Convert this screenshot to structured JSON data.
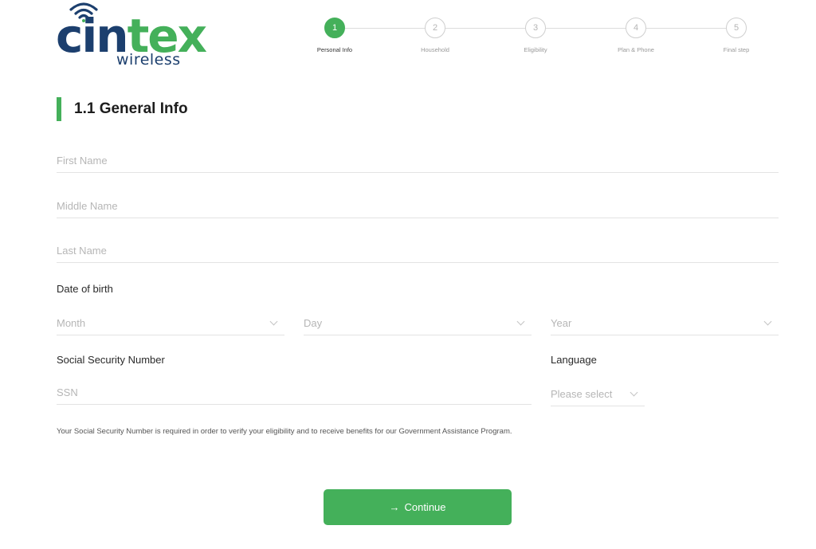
{
  "brand": {
    "name_part1": "cin",
    "name_part2": "tex",
    "tagline": "wireless",
    "primary_color": "#1c3f6e",
    "accent_color": "#44b05a"
  },
  "stepper": {
    "current_step": 1,
    "steps": [
      {
        "number": "1",
        "label": "Personal Info",
        "active": true
      },
      {
        "number": "2",
        "label": "Household",
        "active": false
      },
      {
        "number": "3",
        "label": "Eligibility",
        "active": false
      },
      {
        "number": "4",
        "label": "Plan & Phone",
        "active": false
      },
      {
        "number": "5",
        "label": "Final step",
        "active": false
      }
    ]
  },
  "section": {
    "title": "1.1 General Info"
  },
  "form": {
    "first_name": {
      "placeholder": "First Name",
      "value": ""
    },
    "middle_name": {
      "placeholder": "Middle Name",
      "value": ""
    },
    "last_name": {
      "placeholder": "Last Name",
      "value": ""
    },
    "dob_label": "Date of birth",
    "dob_month": {
      "placeholder": "Month"
    },
    "dob_day": {
      "placeholder": "Day"
    },
    "dob_year": {
      "placeholder": "Year"
    },
    "ssn_label": "Social Security Number",
    "ssn": {
      "placeholder": "SSN",
      "value": ""
    },
    "language_label": "Language",
    "language": {
      "placeholder": "Please select"
    },
    "ssn_note": "Your Social Security Number is required in order to verify your eligibility and to receive benefits for our Government Assistance Program."
  },
  "actions": {
    "continue_label": "Continue",
    "continue_icon": "arrow-right-icon"
  }
}
